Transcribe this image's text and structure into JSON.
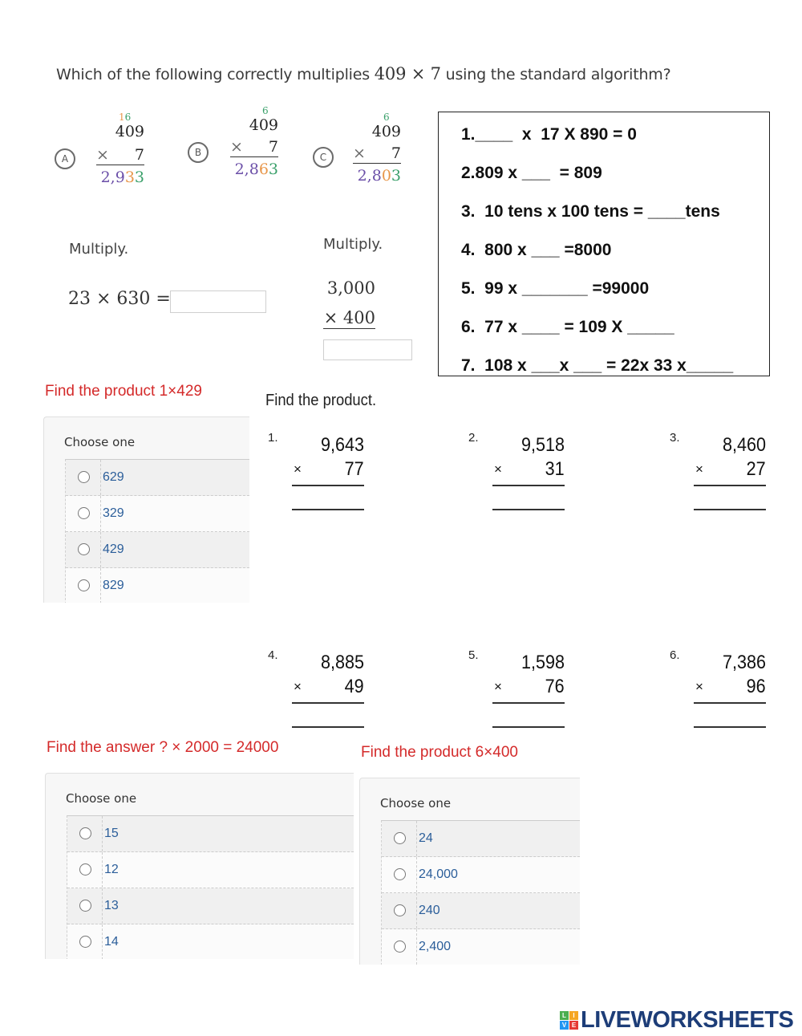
{
  "question": {
    "prefix": "Which of the following correctly multiplies",
    "math": "409 × 7",
    "suffix": "using the standard algorithm?",
    "options": [
      {
        "letter": "A",
        "carry_a": "1",
        "carry_b": "6",
        "top": "409",
        "times": "×",
        "multiplier": "7",
        "result_parts": [
          "2,9",
          "3",
          "3"
        ]
      },
      {
        "letter": "B",
        "carry_a": "",
        "carry_b": "6",
        "top": "409",
        "times": "×",
        "multiplier": "7",
        "result_parts": [
          "2,8",
          "6",
          "3"
        ]
      },
      {
        "letter": "C",
        "carry_a": "",
        "carry_b": "6",
        "top": "409",
        "times": "×",
        "multiplier": "7",
        "result_parts": [
          "2,8",
          "0",
          "3"
        ]
      }
    ]
  },
  "fill_box": {
    "items": [
      "1.____  x  17 X 890 = 0",
      "2.809 x ___  = 809",
      "3.  10 tens x 100 tens = ____tens",
      "4.  800 x ___ =8000",
      "5.  99 x _______ =99000",
      "6.  77 x ____ = 109 X _____",
      "7.  108 x ___x ___ = 22x 33 x_____"
    ]
  },
  "multiply_1": {
    "label": "Multiply.",
    "expression": "23 × 630 =",
    "answer": ""
  },
  "multiply_2": {
    "label": "Multiply.",
    "top": "3,000",
    "bottom": "× 400",
    "answer": ""
  },
  "mc1": {
    "question": "Find the product 1×429",
    "choose_label": "Choose one",
    "options": [
      "629",
      "329",
      "429",
      "829"
    ]
  },
  "find_product": {
    "title": "Find the product.",
    "problems": [
      {
        "num": "1.",
        "top": "9,643",
        "times": "×",
        "bottom": "77"
      },
      {
        "num": "2.",
        "top": "9,518",
        "times": "×",
        "bottom": "31"
      },
      {
        "num": "3.",
        "top": "8,460",
        "times": "×",
        "bottom": "27"
      },
      {
        "num": "4.",
        "top": "8,885",
        "times": "×",
        "bottom": "49"
      },
      {
        "num": "5.",
        "top": "1,598",
        "times": "×",
        "bottom": "76"
      },
      {
        "num": "6.",
        "top": "7,386",
        "times": "×",
        "bottom": "96"
      }
    ]
  },
  "mc2": {
    "question": "Find the answer ? × 2000 = 24000",
    "choose_label": "Choose one",
    "options": [
      "15",
      "12",
      "13",
      "14"
    ]
  },
  "mc3": {
    "question": "Find the product 6×400",
    "choose_label": "Choose one",
    "options": [
      "24",
      "24,000",
      "240",
      "2,400"
    ]
  },
  "logo": {
    "tiles": [
      "L",
      "I",
      "V",
      "E"
    ],
    "tile_colors": [
      "#4caf50",
      "#f5a623",
      "#2196f3",
      "#e53935"
    ],
    "word": "LIVEWORKSHEETS"
  }
}
